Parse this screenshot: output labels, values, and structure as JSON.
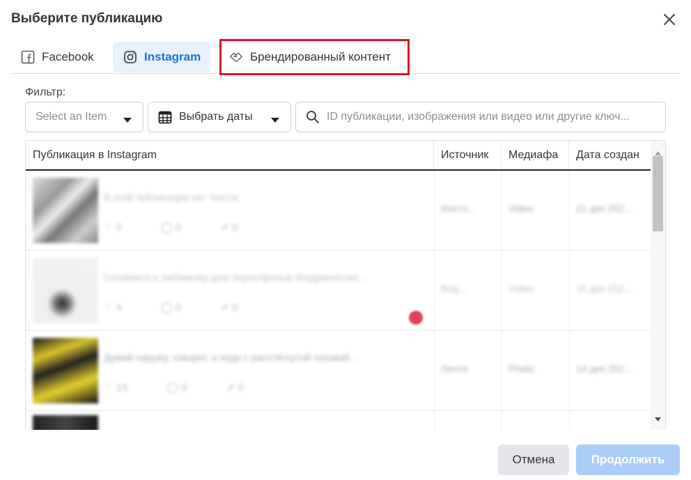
{
  "dialog": {
    "title": "Выберите публикацию"
  },
  "tabs": [
    {
      "label": "Facebook",
      "icon": "facebook-icon"
    },
    {
      "label": "Instagram",
      "icon": "instagram-icon",
      "selected": true
    },
    {
      "label": "Брендированный контент",
      "icon": "handshake-icon"
    }
  ],
  "filter": {
    "label": "Фильтр:",
    "select_placeholder": "Select an Item",
    "dates_label": "Выбрать даты",
    "search_placeholder": "ID публикации, изображения или видео или другие ключ..."
  },
  "table": {
    "columns": [
      "Публикация в Instagram",
      "Источник",
      "Медиафа",
      "Дата создан"
    ],
    "rows": [
      {
        "text": "В этой публикации нет текста",
        "likes": "0",
        "comments": "0",
        "shares": "0",
        "source": "Инсто...",
        "media": "Video",
        "date": "21 дек 202..."
      },
      {
        "text": "Готовимся к любимому дню #культфильм #кадрмнятсво...",
        "likes": "4",
        "comments": "0",
        "shares": "0",
        "source": "Вод...",
        "media": "Video",
        "date": "15 дек 202..."
      },
      {
        "text": "Думай наружу, говорит, а ходи с расстёгнутой головой...",
        "likes": "15",
        "comments": "0",
        "shares": "0",
        "source": "Лента",
        "media": "Photo",
        "date": "14 дек 202..."
      }
    ]
  },
  "buttons": {
    "cancel": "Отмена",
    "continue": "Продолжить"
  },
  "colors": {
    "accent": "#1876d2",
    "highlight_border": "#e0141e",
    "continue_disabled": "#a9cdf7"
  }
}
